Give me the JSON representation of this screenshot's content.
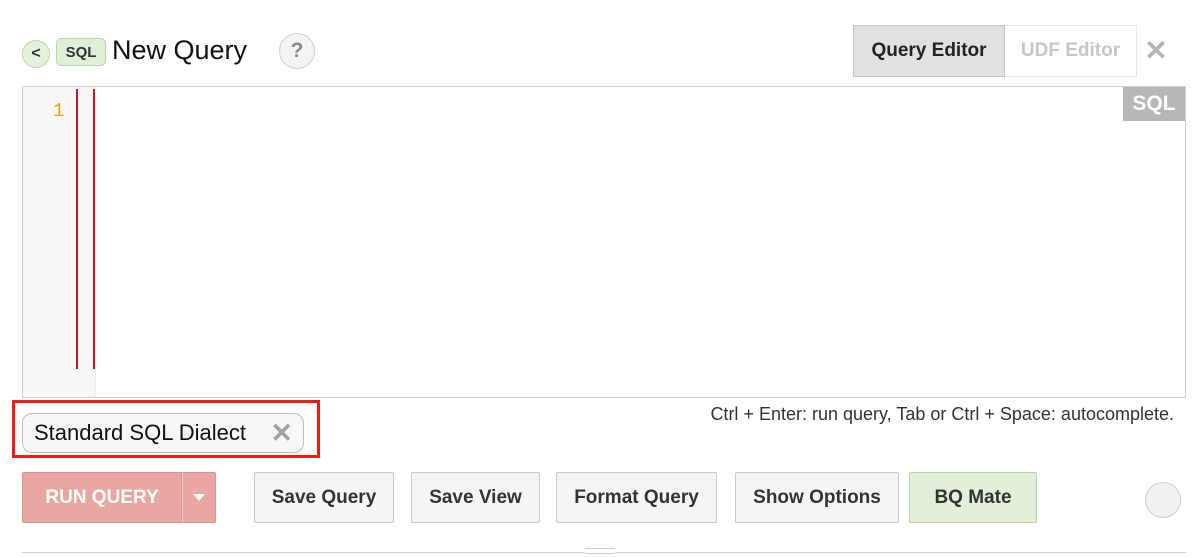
{
  "header": {
    "back_label": "<",
    "sql_pill": "SQL",
    "title": "New Query",
    "help_label": "?",
    "tabs": [
      {
        "label": "Query Editor",
        "active": true
      },
      {
        "label": "UDF Editor",
        "active": false
      }
    ],
    "close_label": "✕"
  },
  "editor": {
    "line_numbers": [
      "1"
    ],
    "content": "",
    "language_badge": "SQL"
  },
  "dialect": {
    "label": "Standard SQL Dialect",
    "remove_label": "✕"
  },
  "hint": "Ctrl + Enter: run query, Tab or Ctrl + Space: autocomplete.",
  "actions": {
    "run": "RUN QUERY",
    "save_query": "Save Query",
    "save_view": "Save View",
    "format_query": "Format Query",
    "show_options": "Show Options",
    "bq_mate": "BQ Mate"
  },
  "colors": {
    "run_button": "#e8a7a1",
    "highlight_box": "#ee1c15",
    "line_number": "#f5a300",
    "bq_mate_bg": "#e2f0da"
  }
}
